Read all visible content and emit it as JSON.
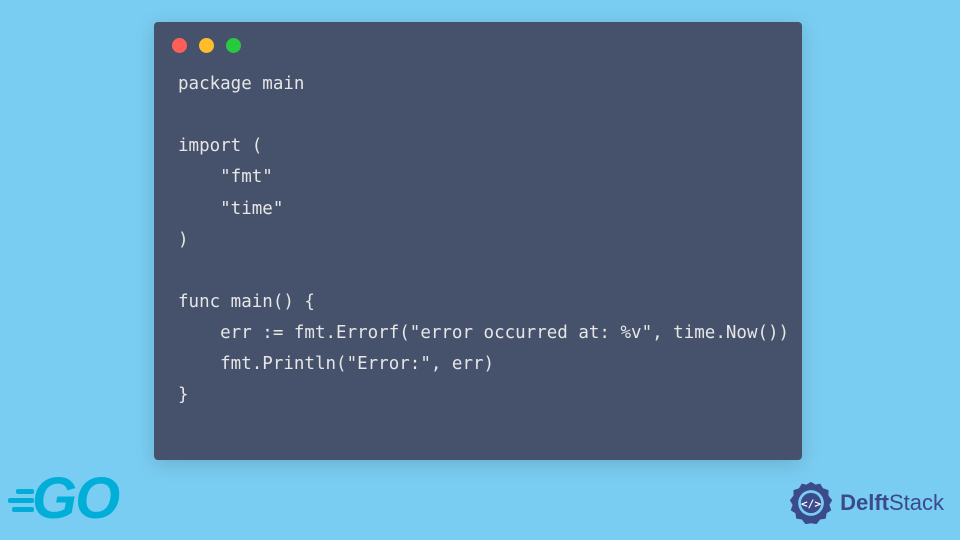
{
  "code": {
    "lines": [
      "package main",
      "",
      "import (",
      "    \"fmt\"",
      "    \"time\"",
      ")",
      "",
      "func main() {",
      "    err := fmt.Errorf(\"error occurred at: %v\", time.Now())",
      "    fmt.Println(\"Error:\", err)",
      "}"
    ]
  },
  "logos": {
    "go": "GO",
    "delft_bold": "Delft",
    "delft_rest": "Stack"
  }
}
